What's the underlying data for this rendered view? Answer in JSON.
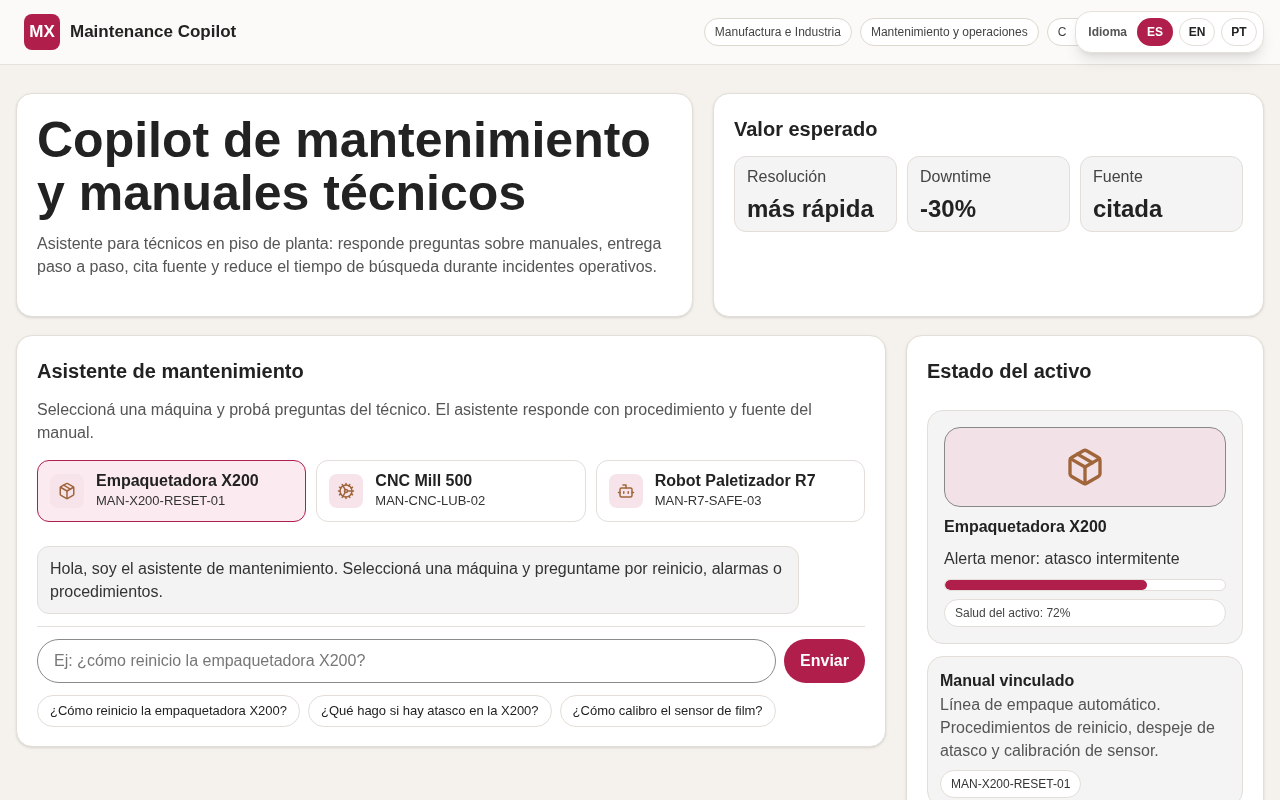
{
  "header": {
    "logo": "MX",
    "title": "Maintenance Copilot",
    "tags": [
      "Manufactura e Industria",
      "Mantenimiento y operaciones",
      "C"
    ],
    "language": {
      "label": "Idioma",
      "options": [
        {
          "label": "ES",
          "selected": true
        },
        {
          "label": "EN",
          "selected": false
        },
        {
          "label": "PT",
          "selected": false
        }
      ]
    }
  },
  "hero": {
    "title": "Copilot de mantenimiento y manuales técnicos",
    "description": "Asistente para técnicos en piso de planta: responde preguntas sobre manuales, entrega paso a paso, cita fuente y reduce el tiempo de búsqueda durante incidentes operativos."
  },
  "value": {
    "title": "Valor esperado",
    "metrics": [
      {
        "label": "Resolución",
        "value": "más rápida"
      },
      {
        "label": "Downtime",
        "value": "-30%"
      },
      {
        "label": "Fuente",
        "value": "citada"
      }
    ]
  },
  "assistant": {
    "title": "Asistente de mantenimiento",
    "description": "Seleccioná una máquina y probá preguntas del técnico. El asistente responde con procedimiento y fuente del manual.",
    "machines": [
      {
        "kind": "package",
        "name": "Empaquetadora X200",
        "code": "MAN-X200-RESET-01",
        "selected": true
      },
      {
        "kind": "gear",
        "name": "CNC Mill 500",
        "code": "MAN-CNC-LUB-02",
        "selected": false
      },
      {
        "kind": "robot",
        "name": "Robot Paletizador R7",
        "code": "MAN-R7-SAFE-03",
        "selected": false
      }
    ],
    "messages": [
      "Hola, soy el asistente de mantenimiento. Seleccioná una máquina y preguntame por reinicio, alarmas o procedimientos."
    ],
    "input": {
      "placeholder": "Ej: ¿cómo reinicio la empaquetadora X200?"
    },
    "send": "Enviar",
    "suggestions": [
      "¿Cómo reinicio la empaquetadora X200?",
      "¿Qué hago si hay atasco en la X200?",
      "¿Cómo calibro el sensor de film?"
    ]
  },
  "status": {
    "title": "Estado del activo",
    "asset": {
      "kind": "package",
      "name": "Empaquetadora X200",
      "alert": "Alerta menor: atasco intermitente",
      "level": 0.72,
      "health": "Salud del activo: 72%"
    },
    "manual": {
      "title": "Manual vinculado",
      "description": "Línea de empaque automático. Procedimientos de reinicio, despeje de atasco y calibración de sensor.",
      "code": "MAN-X200-RESET-01"
    }
  }
}
